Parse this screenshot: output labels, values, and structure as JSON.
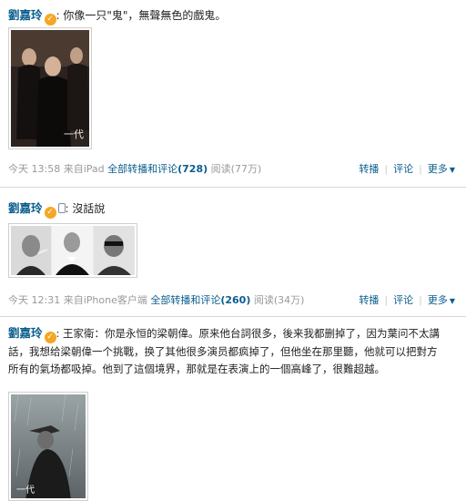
{
  "posts": [
    {
      "author": "劉嘉玲",
      "colon": ":",
      "text": "你像一只\"鬼\"，無聲無色的戲鬼。",
      "time": "今天 13:58",
      "source": "来自iPad",
      "repost_comment_label": "全部转播和评论",
      "repost_comment_count": "(728)",
      "reads": "阅读(77万)"
    },
    {
      "author": "劉嘉玲",
      "colon": ":",
      "text": "沒話說",
      "time": "今天 12:31",
      "source": "来自iPhone客户端",
      "repost_comment_label": "全部转播和评论",
      "repost_comment_count": "(260)",
      "reads": "阅读(34万)"
    },
    {
      "author": "劉嘉玲",
      "colon": ":",
      "text_line1": "王家衛：你是永恒的梁朝偉。原来他台詞很多，後来我都删掉了，因为葉问不太講",
      "text_line2": "話，我想给梁朝偉一个挑戰，换了其他很多演员都疯掉了，但他坐在那里聽，他就可以把對方",
      "text_line3": "所有的氣场都吸掉。他到了這個境界，那就是在表演上的一個高峰了，很難超越。"
    }
  ],
  "actions": {
    "repost": "转播",
    "comment": "评论",
    "more": "更多",
    "sep": "|"
  },
  "badge_glyph": "✓"
}
